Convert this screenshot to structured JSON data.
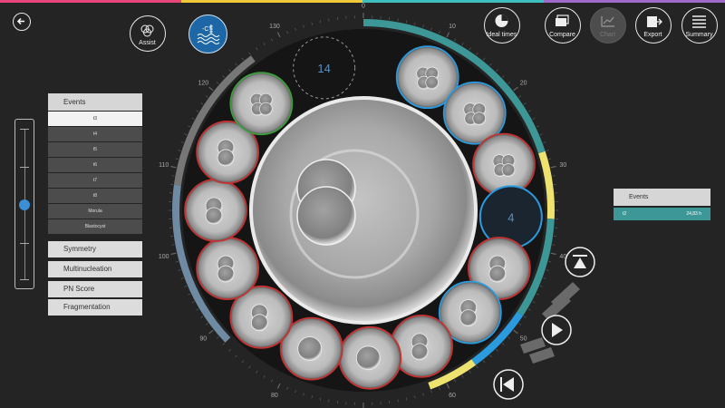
{
  "colors": {
    "accent": "#3e9797",
    "selected_blue": "#2b9be0",
    "cancel_red": "#c43232",
    "good_green": "#3c9e3c",
    "highlight_yellow": "#efe370"
  },
  "toolbar": {
    "back_icon": "back-arrow-icon",
    "assist_label": "Assist",
    "ideal_times_label": "Ideal times",
    "compare_label": "Compare",
    "graph_label": "Chart",
    "export_label": "Export",
    "summary_label": "Summary"
  },
  "events_panel": {
    "header": "Events",
    "items": [
      "t3",
      "t4",
      "t5",
      "t6",
      "t7",
      "t8",
      "Morula",
      "Blastocyst"
    ],
    "selected_index": 0
  },
  "options": [
    "Symmetry",
    "Multinucleation",
    "PN Score",
    "Fragmentation"
  ],
  "slider": {
    "value_fraction": 0.5
  },
  "right_events": {
    "header": "Events",
    "rows": [
      {
        "event": "t2",
        "time": "24,83 h"
      }
    ]
  },
  "dish": {
    "dial_labels": [
      "0",
      "10",
      "20",
      "30",
      "40",
      "50",
      "60",
      "70",
      "80",
      "90",
      "100",
      "110",
      "120",
      "130"
    ],
    "empty_well_number": "14",
    "selected_well_number": "4"
  },
  "playback": {
    "icons": [
      "go-first-icon",
      "play-icon",
      "go-last-icon",
      "step-back-chevrons-icon",
      "step-forward-chevrons-icon"
    ]
  }
}
